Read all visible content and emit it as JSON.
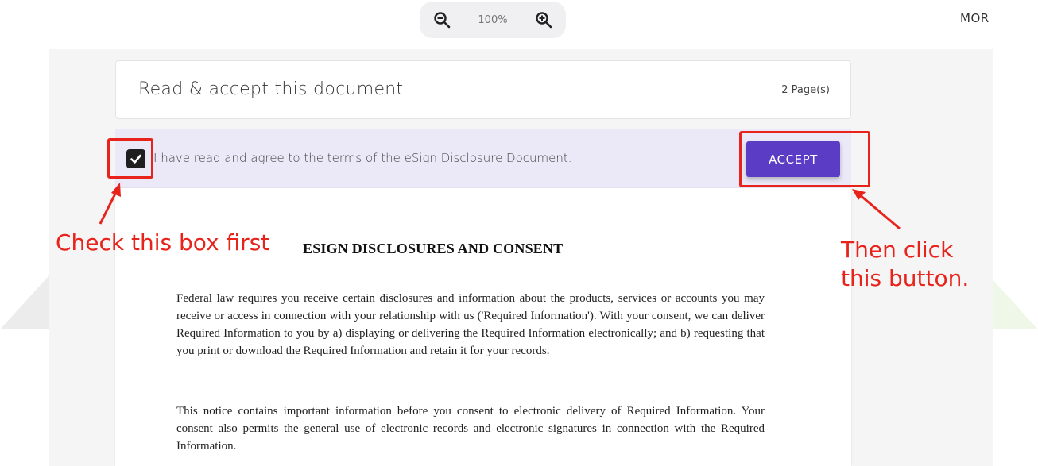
{
  "toolbar": {
    "zoom_level": "100%",
    "more_label": "MOR"
  },
  "document": {
    "title": "Read & accept this document",
    "pages": "2 Page(s)"
  },
  "agreement": {
    "checked": true,
    "text": "I have read and agree to the terms of the eSign Disclosure Document.",
    "accept_label": "ACCEPT"
  },
  "content": {
    "heading": "ESIGN DISCLOSURES AND CONSENT",
    "paragraph_1": "Federal law requires you receive certain disclosures and information about the products, services or accounts you may receive or access in connection with your relationship with us ('Required Information'). With your consent, we can deliver Required Information to you by a) displaying or delivering the Required Information electronically; and b) requesting that you print or download the Required Information and retain it for your records.",
    "paragraph_2": "This notice contains important information before you consent to electronic delivery of Required Information. Your consent also permits the general use of electronic records and electronic signatures in connection with the Required Information."
  },
  "annotations": {
    "left_note": "Check this box first",
    "right_note_line1": "Then click",
    "right_note_line2": "this button."
  },
  "colors": {
    "accent": "#5b3cc4",
    "annotation": "#e8231c",
    "agree_bar": "#ebe9f7"
  }
}
